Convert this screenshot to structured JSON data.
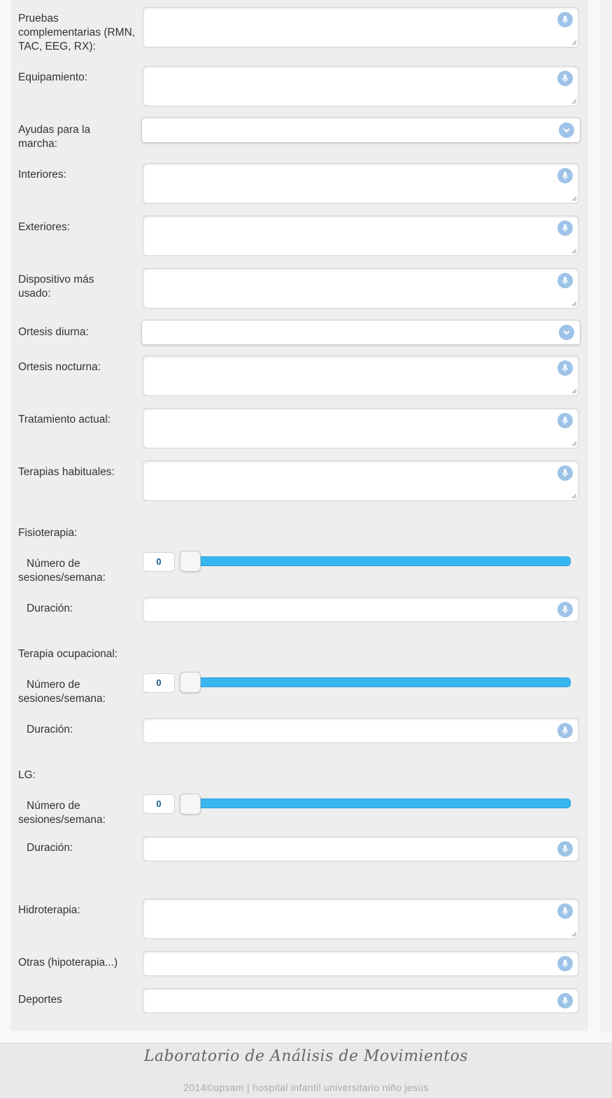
{
  "fields": {
    "pruebas": {
      "label": "Pruebas complementarias (RMN, TAC, EEG, RX):",
      "value": ""
    },
    "equipamiento": {
      "label": "Equipamiento:",
      "value": ""
    },
    "ayudas": {
      "label": "Ayudas para la marcha:",
      "value": ""
    },
    "interiores": {
      "label": "Interiores:",
      "value": ""
    },
    "exteriores": {
      "label": "Exteriores:",
      "value": ""
    },
    "dispositivo": {
      "label": "Dispositivo más usado:",
      "value": ""
    },
    "ortesis_diurna": {
      "label": "Ortesis diurna:",
      "value": ""
    },
    "ortesis_nocturna": {
      "label": "Ortesis nocturna:",
      "value": ""
    },
    "tratamiento": {
      "label": "Tratamiento actual:",
      "value": ""
    },
    "terapias": {
      "label": "Terapias habituales:",
      "value": ""
    },
    "hidroterapia": {
      "label": "Hidroterapia:",
      "value": ""
    },
    "otras": {
      "label": "Otras (hipoterapia...)",
      "value": ""
    },
    "deportes": {
      "label": "Deportes",
      "value": ""
    }
  },
  "therapies": [
    {
      "title": "Fisioterapia:",
      "sessions_label": "Número de sesiones/semana:",
      "sessions": "0",
      "duration_label": "Duración:",
      "duration": ""
    },
    {
      "title": "Terapia ocupacional:",
      "sessions_label": "Número de sesiones/semana:",
      "sessions": "0",
      "duration_label": "Duración:",
      "duration": ""
    },
    {
      "title": "LG:",
      "sessions_label": "Número de sesiones/semana:",
      "sessions": "0",
      "duration_label": "Duración:",
      "duration": ""
    }
  ],
  "icons": {
    "mic": "microphone-icon",
    "chevron": "chevron-down-icon"
  },
  "colors": {
    "accent": "#38b6f0",
    "icon_bg": "#9ec3e8",
    "number": "#1a5a8a"
  },
  "footer": {
    "brand": "Laboratorio de Análisis de Movimientos",
    "copyright": "2014©upsam | hospital infantil universitario niño jesús"
  }
}
